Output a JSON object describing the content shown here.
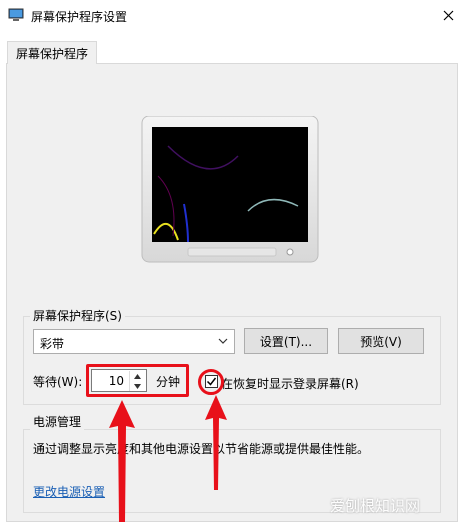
{
  "window": {
    "title": "屏幕保护程序设置",
    "close_icon": "close-icon"
  },
  "tabs": [
    {
      "label": "屏幕保护程序"
    }
  ],
  "screensaver": {
    "group_label": "屏幕保护程序(S)",
    "selected": "彩带",
    "settings_button": "设置(T)...",
    "preview_button": "预览(V)",
    "wait_label": "等待(W):",
    "wait_value": "10",
    "wait_unit": "分钟",
    "resume_checkbox_label": "在恢复时显示登录屏幕(R)",
    "resume_checked": true
  },
  "power": {
    "group_label": "电源管理",
    "description": "通过调整显示亮度和其他电源设置以节省能源或提供最佳性能。",
    "link": "更改电源设置"
  },
  "annotations": {
    "highlight_color": "#e8101a"
  },
  "watermark": "爱刨根知识网"
}
